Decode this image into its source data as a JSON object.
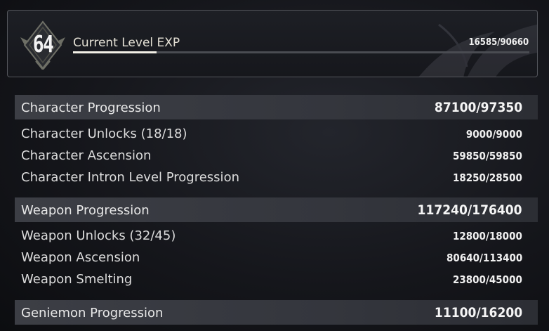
{
  "exp": {
    "level": "64",
    "label": "Current Level EXP",
    "value": "16585/90660",
    "progress_fraction": 0.183
  },
  "sections": [
    {
      "label": "Character Progression",
      "value": "87100/97350",
      "rows": [
        {
          "label": "Character Unlocks (18/18)",
          "value": "9000/9000"
        },
        {
          "label": "Character Ascension",
          "value": "59850/59850"
        },
        {
          "label": "Character Intron Level Progression",
          "value": "18250/28500"
        }
      ]
    },
    {
      "label": "Weapon Progression",
      "value": "117240/176400",
      "rows": [
        {
          "label": "Weapon Unlocks (32/45)",
          "value": "12800/18000"
        },
        {
          "label": "Weapon Ascension",
          "value": "80640/113400"
        },
        {
          "label": "Weapon Smelting",
          "value": "23800/45000"
        }
      ]
    },
    {
      "label": "Geniemon Progression",
      "value": "11100/16200",
      "rows": []
    }
  ],
  "colors": {
    "section_bg": "#3a3c43",
    "bar_fill": "#f2efe6",
    "bar_track": "#4a4c52"
  }
}
